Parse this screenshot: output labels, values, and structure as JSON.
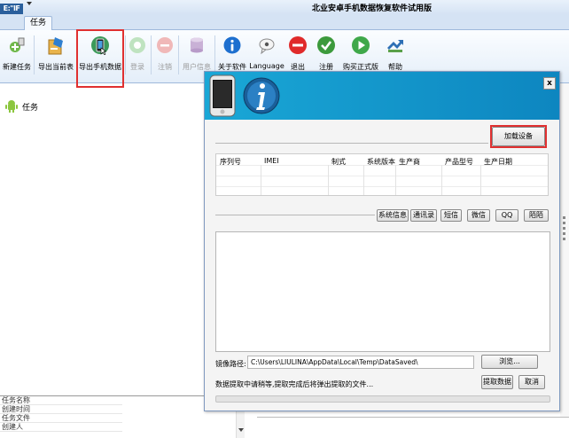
{
  "app": {
    "logo_text": "E:\"IF",
    "title": "北业安卓手机数据恢复软件试用版"
  },
  "ribbon": {
    "tab_label": "任务"
  },
  "toolbar": {
    "items": [
      {
        "label": "新建任务",
        "icon": "new-task-icon",
        "enabled": true
      },
      {
        "label": "导出当前表",
        "icon": "export-table-icon",
        "enabled": true
      },
      {
        "label": "导出手机数据",
        "icon": "export-phone-data-icon",
        "enabled": true,
        "highlighted": true
      },
      {
        "label": "登录",
        "icon": "login-icon",
        "enabled": false
      },
      {
        "label": "注销",
        "icon": "logout-icon",
        "enabled": false
      },
      {
        "label": "用户信息",
        "icon": "user-info-icon",
        "enabled": false
      },
      {
        "label": "关于软件",
        "icon": "about-icon",
        "enabled": true
      },
      {
        "label": "Language",
        "icon": "language-icon",
        "enabled": true
      },
      {
        "label": "退出",
        "icon": "exit-icon",
        "enabled": true
      },
      {
        "label": "注册",
        "icon": "register-icon",
        "enabled": true
      },
      {
        "label": "购买正式版",
        "icon": "buy-icon",
        "enabled": true
      },
      {
        "label": "帮助",
        "icon": "help-icon",
        "enabled": true
      }
    ]
  },
  "tree": {
    "root_label": "任务"
  },
  "properties": {
    "rows": [
      "任务名称",
      "创建时间",
      "任务文件",
      "创建人"
    ]
  },
  "dialog": {
    "close_label": "x",
    "load_device_label": "加载设备",
    "device_table": {
      "columns": [
        "序列号",
        "IMEI",
        "制式",
        "系统版本",
        "生产商",
        "产品型号",
        "生产日期"
      ]
    },
    "data_buttons": [
      "系统信息",
      "通讯录",
      "短信",
      "微信",
      "QQ",
      "陌陌"
    ],
    "path_label": "镜像路径:",
    "path_value": "C:\\Users\\LIULINA\\AppData\\Local\\Temp\\DataSaved\\",
    "browse_label": "浏览...",
    "status_text": "数据提取中请稍等,提取完成后将弹出提取的文件...",
    "extract_label": "提取数据",
    "cancel_label": "取消",
    "progress_fraction": 0.0
  },
  "colors": {
    "accent": "#1aa7d6",
    "highlight_border": "#e03030",
    "ribbon_bg": "#d5e3f4"
  }
}
